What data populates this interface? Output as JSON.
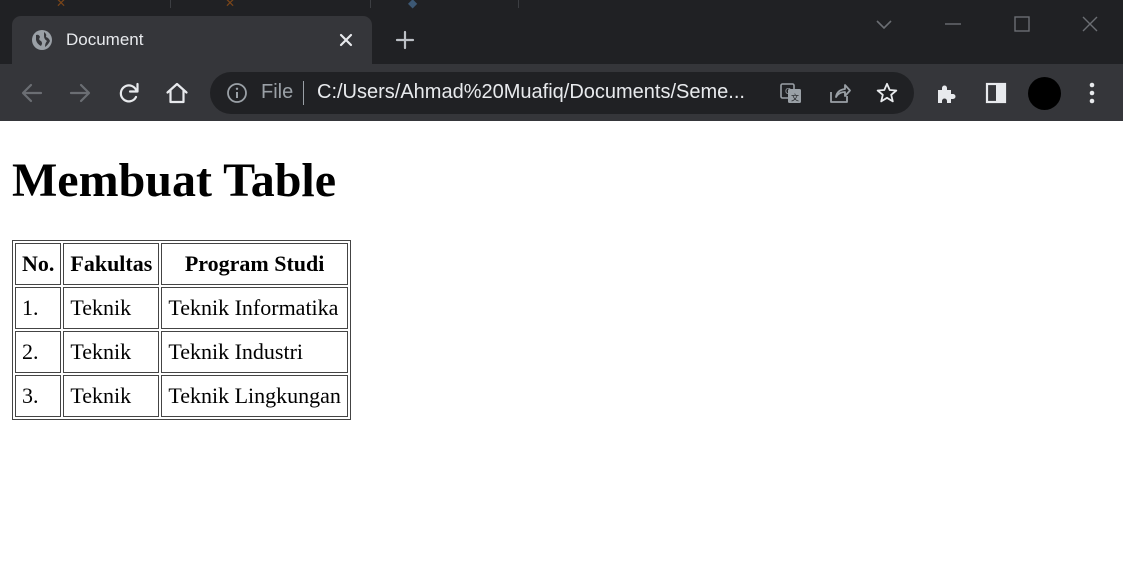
{
  "browser": {
    "tab": {
      "title": "Document"
    },
    "omnibox": {
      "scheme_label": "File",
      "url": "C:/Users/Ahmad%20Muafiq/Documents/Seme..."
    },
    "colors": {
      "frame": "#202124",
      "toolbar": "#35363a",
      "omnibox": "#202124",
      "text": "#e8eaed",
      "icon": "#e8eaed",
      "dim": "#9aa0a6"
    }
  },
  "page": {
    "heading": "Membuat Table",
    "table": {
      "headers": [
        "No.",
        "Fakultas",
        "Program Studi"
      ],
      "rows": [
        [
          "1.",
          "Teknik",
          "Teknik Informatika"
        ],
        [
          "2.",
          "Teknik",
          "Teknik Industri"
        ],
        [
          "3.",
          "Teknik",
          "Teknik Lingkungan"
        ]
      ]
    }
  }
}
